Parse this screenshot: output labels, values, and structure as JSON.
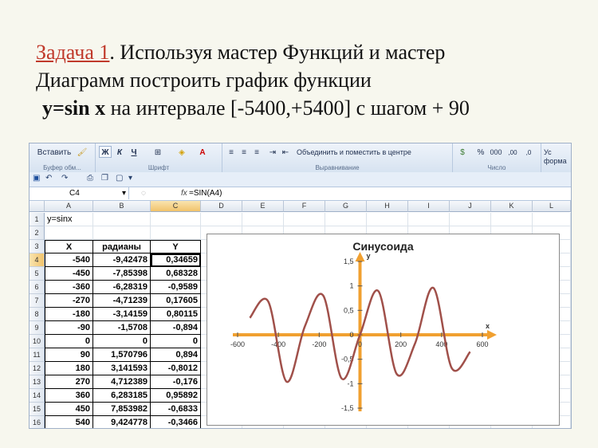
{
  "task": {
    "link": "Задача 1",
    "line1_rest": ". Используя мастер Функций и мастер",
    "line2": "Диаграмм построить график функции",
    "func": "y=sin x",
    "line3_rest": " на интервале [-5400,+5400] с шагом + 90"
  },
  "ribbon": {
    "paste": "Вставить",
    "bold": "Ж",
    "italic": "К",
    "underline": "Ч",
    "merge": "Объединить и поместить в центре",
    "percent": "%",
    "thousands": "000",
    "dec_inc": ",00",
    "dec_dec": ",0",
    "styles_1": "Ус",
    "styles_2": "форма",
    "groups": [
      "Буфер обм...",
      "Шрифт",
      "Выравнивание",
      "Число"
    ],
    "accent": "#d7e3f1"
  },
  "formula_bar": {
    "name_box": "C4",
    "fx": "fx",
    "formula": "=SIN(A4)"
  },
  "sheet": {
    "columns": [
      "A",
      "B",
      "C",
      "D",
      "E",
      "F",
      "G",
      "H",
      "I",
      "J",
      "K",
      "L"
    ],
    "row_numbers": [
      "1",
      "2",
      "3",
      "4",
      "5",
      "6",
      "7",
      "8",
      "9",
      "10",
      "11",
      "12",
      "13",
      "14",
      "15",
      "16"
    ],
    "a1": "y=sinx",
    "headers": [
      "X",
      "радианы",
      "Y"
    ],
    "rows": [
      [
        "-540",
        "-9,42478",
        "0,34659"
      ],
      [
        "-450",
        "-7,85398",
        "0,68328"
      ],
      [
        "-360",
        "-6,28319",
        "-0,9589"
      ],
      [
        "-270",
        "-4,71239",
        "0,17605"
      ],
      [
        "-180",
        "-3,14159",
        "0,80115"
      ],
      [
        "-90",
        "-1,5708",
        "-0,894"
      ],
      [
        "0",
        "0",
        "0"
      ],
      [
        "90",
        "1,570796",
        "0,894"
      ],
      [
        "180",
        "3,141593",
        "-0,8012"
      ],
      [
        "270",
        "4,712389",
        "-0,176"
      ],
      [
        "360",
        "6,283185",
        "0,95892"
      ],
      [
        "450",
        "7,853982",
        "-0,6833"
      ],
      [
        "540",
        "9,424778",
        "-0,3466"
      ]
    ]
  },
  "chart_data": {
    "type": "line",
    "title": "Синусоида",
    "xlabel": "x",
    "ylabel": "y",
    "xlim": [
      -600,
      600
    ],
    "ylim": [
      -1.5,
      1.5
    ],
    "x_ticks": [
      "-600",
      "-400",
      "-200",
      "0",
      "200",
      "400",
      "600"
    ],
    "y_ticks": [
      "1,5",
      "1",
      "0,5",
      "0",
      "-0,5",
      "-1",
      "-1,5"
    ],
    "grid": false,
    "series_color": "#a0504a",
    "axis_color": "#f0a030",
    "series": [
      {
        "x": [
          -540,
          -450,
          -360,
          -270,
          -180,
          -90,
          0,
          90,
          180,
          270,
          360,
          450,
          540
        ],
        "values": [
          0.34659,
          0.68328,
          -0.9589,
          0.17605,
          0.80115,
          -0.894,
          0,
          0.894,
          -0.8012,
          -0.176,
          0.95892,
          -0.6833,
          -0.3466
        ]
      }
    ]
  }
}
